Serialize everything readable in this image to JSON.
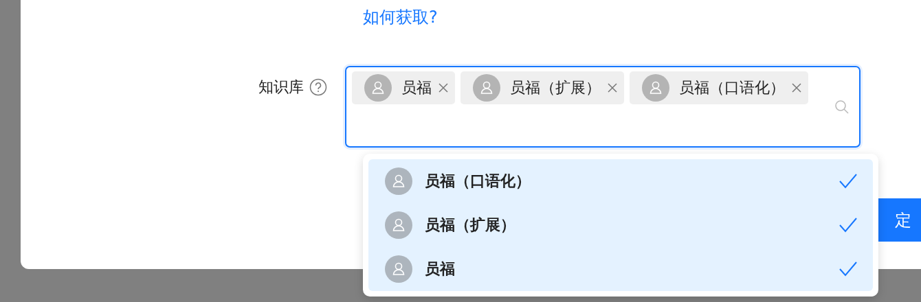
{
  "help_link": "如何获取?",
  "knowledge_base": {
    "label": "知识库",
    "tags": [
      {
        "label": "员福"
      },
      {
        "label": "员福（扩展）"
      },
      {
        "label": "员福（口语化）"
      }
    ]
  },
  "dropdown": {
    "options": [
      {
        "label": "员福（口语化）",
        "selected": true
      },
      {
        "label": "员福（扩展）",
        "selected": true
      },
      {
        "label": "员福",
        "selected": true
      }
    ]
  },
  "confirm_button": "定"
}
